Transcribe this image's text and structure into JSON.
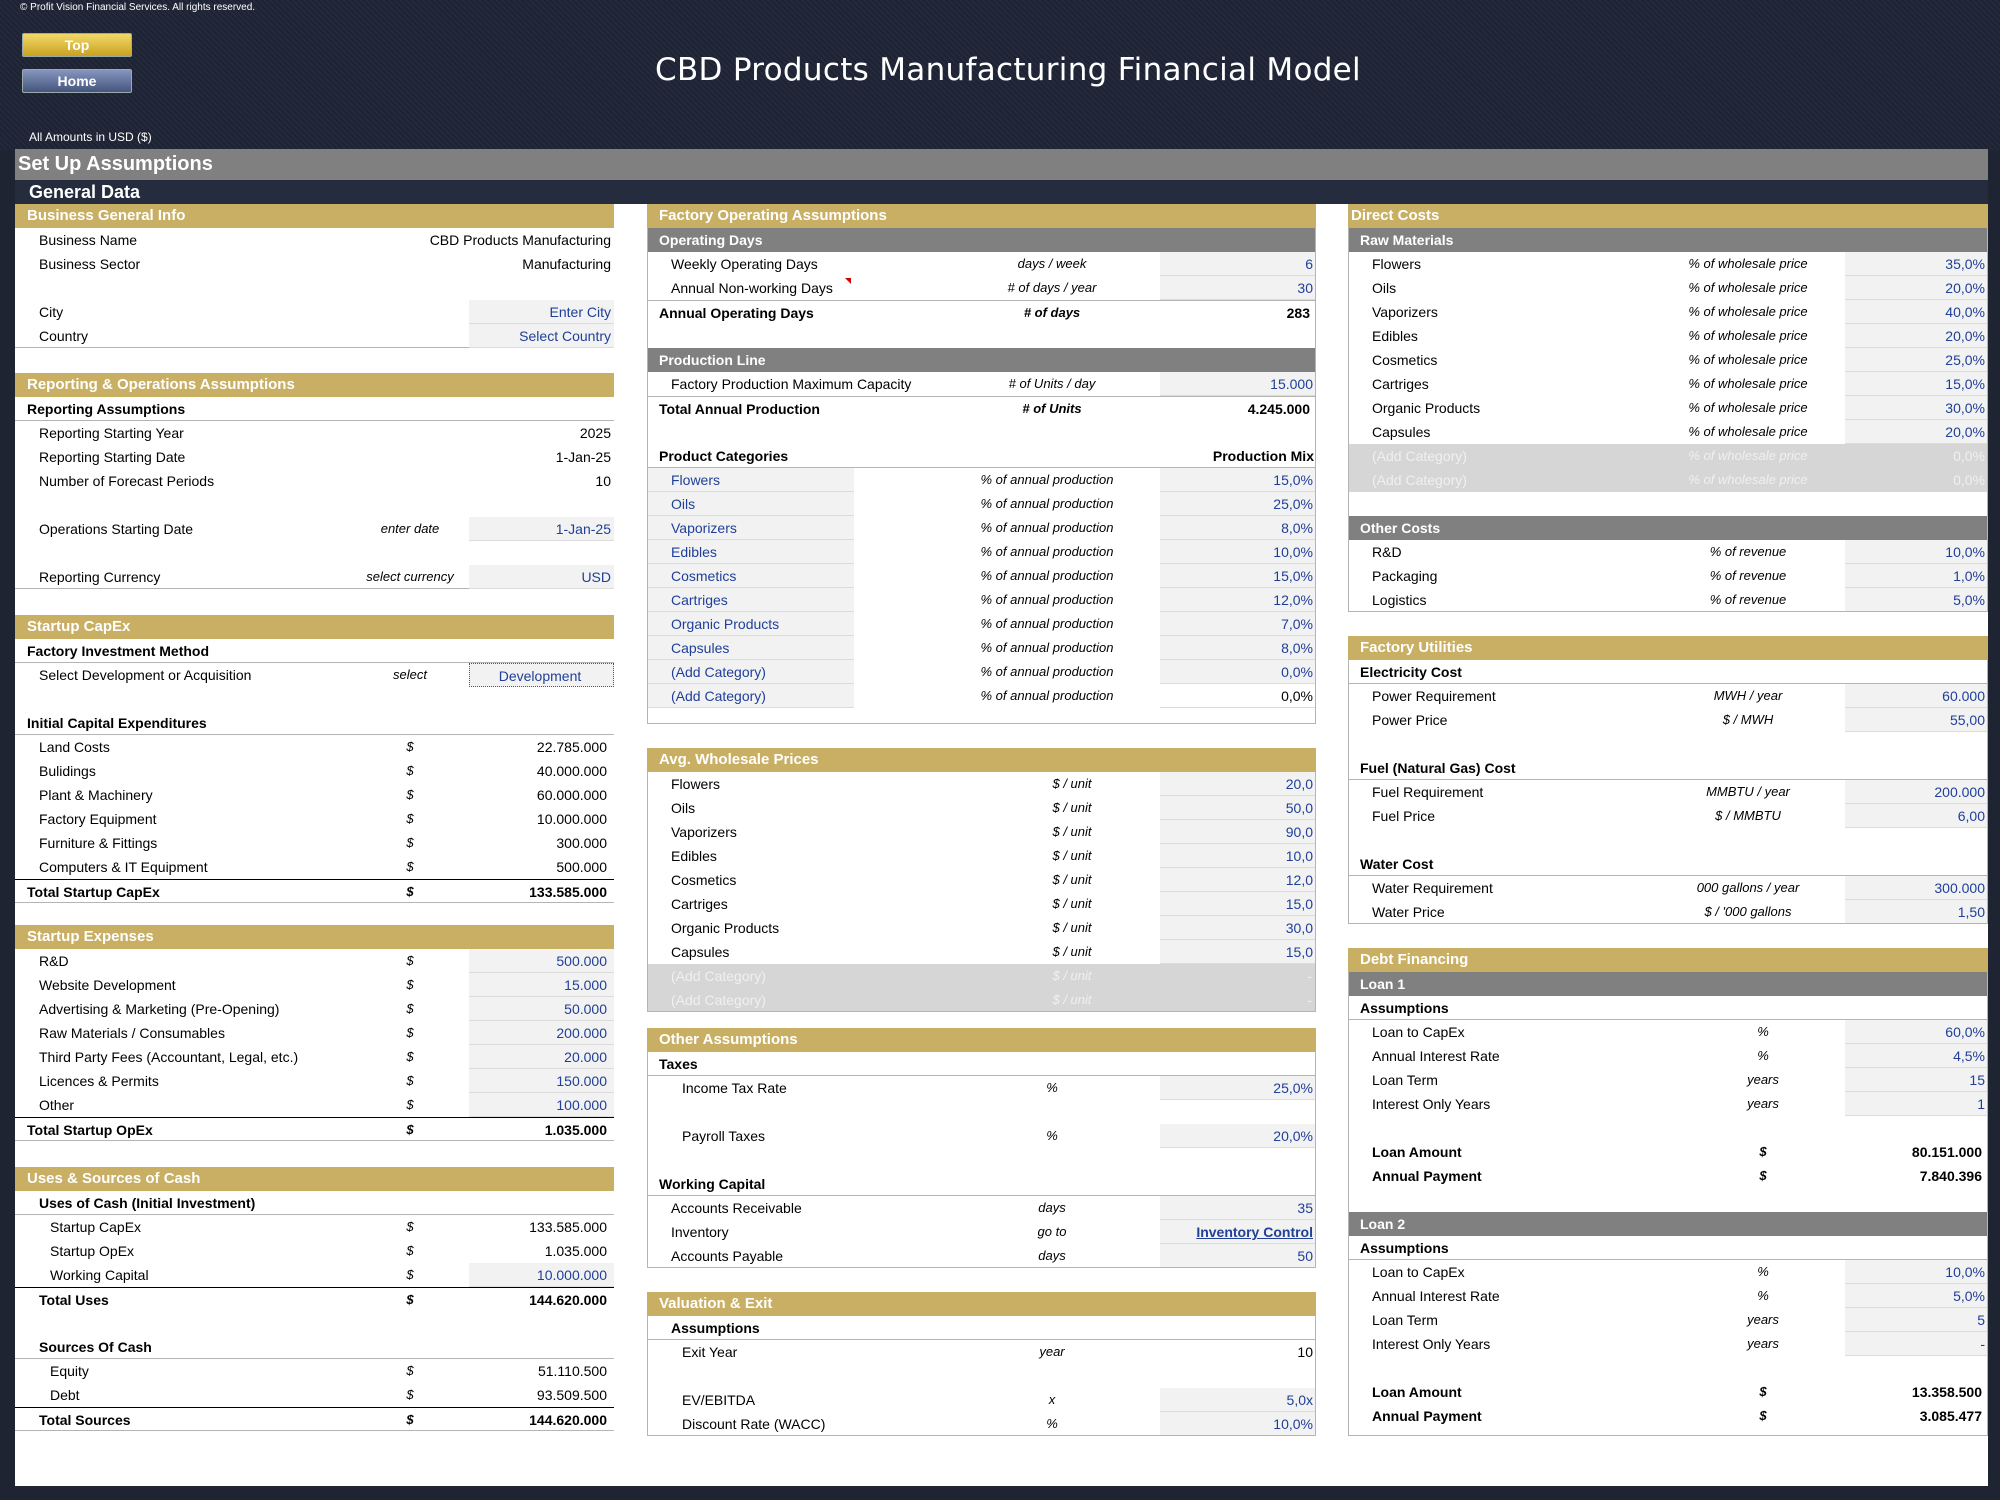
{
  "header": {
    "copyright": "© Profit Vision Financial Services. All rights reserved.",
    "top_button": "Top",
    "home_button": "Home",
    "title": "CBD Products Manufacturing Financial Model",
    "amounts": "All Amounts in  USD ($)"
  },
  "sections": {
    "setup": "Set Up Assumptions",
    "general": "General Data"
  },
  "business": {
    "title": "Business General Info",
    "name_label": "Business Name",
    "name_value": "CBD Products Manufacturing",
    "sector_label": "Business Sector",
    "sector_value": "Manufacturing",
    "city_label": "City",
    "city_value": "Enter City",
    "country_label": "Country",
    "country_value": "Select Country"
  },
  "reporting": {
    "title": "Reporting & Operations Assumptions",
    "sub": "Reporting Assumptions",
    "year_label": "Reporting Starting Year",
    "year_value": "2025",
    "date_label": "Reporting Starting Date",
    "date_value": "1-Jan-25",
    "periods_label": "Number of Forecast Periods",
    "periods_value": "10",
    "ops_label": "Operations Starting Date",
    "ops_unit": "enter date",
    "ops_value": "1-Jan-25",
    "currency_label": "Reporting Currency",
    "currency_unit": "select currency",
    "currency_value": "USD"
  },
  "capex": {
    "title": "Startup CapEx",
    "method_title": "Factory Investment Method",
    "select_label": "Select Development or Acquisition",
    "select_unit": "select",
    "select_value": "Development",
    "initial_title": "Initial Capital Expenditures",
    "items": [
      {
        "label": "Land Costs",
        "unit": "$",
        "value": "22.785.000"
      },
      {
        "label": "Bulidings",
        "unit": "$",
        "value": "40.000.000"
      },
      {
        "label": "Plant & Machinery",
        "unit": "$",
        "value": "60.000.000"
      },
      {
        "label": "Factory Equipment",
        "unit": "$",
        "value": "10.000.000"
      },
      {
        "label": "Furniture & Fittings",
        "unit": "$",
        "value": "300.000"
      },
      {
        "label": "Computers & IT Equipment",
        "unit": "$",
        "value": "500.000"
      }
    ],
    "total_label": "Total Startup CapEx",
    "total_unit": "$",
    "total_value": "133.585.000"
  },
  "expenses": {
    "title": "Startup Expenses",
    "items": [
      {
        "label": "R&D",
        "unit": "$",
        "value": "500.000"
      },
      {
        "label": "Website Development",
        "unit": "$",
        "value": "15.000"
      },
      {
        "label": "Advertising & Marketing (Pre-Opening)",
        "unit": "$",
        "value": "50.000"
      },
      {
        "label": "Raw Materials / Consumables",
        "unit": "$",
        "value": "200.000"
      },
      {
        "label": "Third Party Fees (Accountant, Legal, etc.)",
        "unit": "$",
        "value": "20.000"
      },
      {
        "label": "Licences & Permits",
        "unit": "$",
        "value": "150.000"
      },
      {
        "label": "Other",
        "unit": "$",
        "value": "100.000"
      }
    ],
    "total_label": "Total Startup OpEx",
    "total_unit": "$",
    "total_value": "1.035.000"
  },
  "uses": {
    "title": "Uses & Sources of Cash",
    "uses_title": "Uses of Cash (Initial Investment)",
    "capex_label": "Startup CapEx",
    "capex_unit": "$",
    "capex_value": "133.585.000",
    "opex_label": "Startup OpEx",
    "opex_unit": "$",
    "opex_value": "1.035.000",
    "wc_label": "Working Capital",
    "wc_unit": "$",
    "wc_value": "10.000.000",
    "total_uses_label": "Total Uses",
    "total_uses_unit": "$",
    "total_uses_value": "144.620.000",
    "sources_title": "Sources Of Cash",
    "equity_label": "Equity",
    "equity_unit": "$",
    "equity_value": "51.110.500",
    "debt_label": "Debt",
    "debt_unit": "$",
    "debt_value": "93.509.500",
    "total_sources_label": "Total Sources",
    "total_sources_unit": "$",
    "total_sources_value": "144.620.000"
  },
  "factory": {
    "title": "Factory Operating Assumptions",
    "opdays_title": "Operating Days",
    "weekly_label": "Weekly Operating Days",
    "weekly_unit": "days / week",
    "weekly_value": "6",
    "nonwork_label": "Annual Non-working Days",
    "nonwork_unit": "# of days / year",
    "nonwork_value": "30",
    "annual_label": "Annual Operating Days",
    "annual_unit": "# of days",
    "annual_value": "283",
    "prod_title": "Production Line",
    "capacity_label": "Factory Production Maximum Capacity",
    "capacity_unit": "# of Units / day",
    "capacity_value": "15.000",
    "total_prod_label": "Total Annual Production",
    "total_prod_unit": "# of Units",
    "total_prod_value": "4.245.000",
    "cats_title": "Product Categories",
    "mix_title": "Production Mix",
    "categories": [
      {
        "label": "Flowers",
        "unit": "% of annual production",
        "value": "15,0%"
      },
      {
        "label": "Oils",
        "unit": "% of annual production",
        "value": "25,0%"
      },
      {
        "label": "Vaporizers",
        "unit": "% of annual production",
        "value": "8,0%"
      },
      {
        "label": "Edibles",
        "unit": "% of annual production",
        "value": "10,0%"
      },
      {
        "label": "Cosmetics",
        "unit": "% of annual production",
        "value": "15,0%"
      },
      {
        "label": "Cartriges",
        "unit": "% of annual production",
        "value": "12,0%"
      },
      {
        "label": "Organic Products",
        "unit": "% of annual production",
        "value": "7,0%"
      },
      {
        "label": "Capsules",
        "unit": "% of annual production",
        "value": "8,0%"
      },
      {
        "label": "(Add Category)",
        "unit": "% of annual production",
        "value": "0,0%"
      },
      {
        "label": "(Add Category)",
        "unit": "% of annual production",
        "value": "0,0%"
      }
    ]
  },
  "prices": {
    "title": "Avg. Wholesale Prices",
    "items": [
      {
        "label": "Flowers",
        "unit": "$ / unit",
        "value": "20,0"
      },
      {
        "label": "Oils",
        "unit": "$ / unit",
        "value": "50,0"
      },
      {
        "label": "Vaporizers",
        "unit": "$ / unit",
        "value": "90,0"
      },
      {
        "label": "Edibles",
        "unit": "$ / unit",
        "value": "10,0"
      },
      {
        "label": "Cosmetics",
        "unit": "$ / unit",
        "value": "12,0"
      },
      {
        "label": "Cartriges",
        "unit": "$ / unit",
        "value": "15,0"
      },
      {
        "label": "Organic Products",
        "unit": "$ / unit",
        "value": "30,0"
      },
      {
        "label": "Capsules",
        "unit": "$ / unit",
        "value": "15,0"
      }
    ],
    "disabled": [
      {
        "label": "(Add Category)",
        "unit": "$ / unit",
        "value": "-"
      },
      {
        "label": "(Add Category)",
        "unit": "$ / unit",
        "value": "-"
      }
    ]
  },
  "other": {
    "title": "Other Assumptions",
    "taxes_title": "Taxes",
    "income_label": "Income Tax Rate",
    "income_unit": "%",
    "income_value": "25,0%",
    "payroll_label": "Payroll Taxes",
    "payroll_unit": "%",
    "payroll_value": "20,0%",
    "wc_title": "Working Capital",
    "ar_label": "Accounts Receivable",
    "ar_unit": "days",
    "ar_value": "35",
    "inv_label": "Inventory",
    "inv_unit": "go to",
    "inv_value": "Inventory Control",
    "ap_label": "Accounts Payable",
    "ap_unit": "days",
    "ap_value": "50"
  },
  "valuation": {
    "title": "Valuation & Exit",
    "sub": "Assumptions",
    "exit_label": "Exit Year",
    "exit_unit": "year",
    "exit_value": "10",
    "ev_label": "EV/EBITDA",
    "ev_unit": "x",
    "ev_value": "5,0x",
    "wacc_label": "Discount Rate (WACC)",
    "wacc_unit": "%",
    "wacc_value": "10,0%"
  },
  "direct": {
    "title": "Direct Costs",
    "raw_title": "Raw Materials",
    "raw": [
      {
        "label": "Flowers",
        "unit": "% of wholesale price",
        "value": "35,0%"
      },
      {
        "label": "Oils",
        "unit": "% of wholesale price",
        "value": "20,0%"
      },
      {
        "label": "Vaporizers",
        "unit": "% of wholesale price",
        "value": "40,0%"
      },
      {
        "label": "Edibles",
        "unit": "% of wholesale price",
        "value": "20,0%"
      },
      {
        "label": "Cosmetics",
        "unit": "% of wholesale price",
        "value": "25,0%"
      },
      {
        "label": "Cartriges",
        "unit": "% of wholesale price",
        "value": "15,0%"
      },
      {
        "label": "Organic Products",
        "unit": "% of wholesale price",
        "value": "30,0%"
      },
      {
        "label": "Capsules",
        "unit": "% of wholesale price",
        "value": "20,0%"
      }
    ],
    "raw_disabled": [
      {
        "label": "(Add Category)",
        "unit": "% of wholesale price",
        "value": "0,0%"
      },
      {
        "label": "(Add Category)",
        "unit": "% of wholesale price",
        "value": "0,0%"
      }
    ],
    "other_title": "Other Costs",
    "other": [
      {
        "label": "R&D",
        "unit": "% of revenue",
        "value": "10,0%"
      },
      {
        "label": "Packaging",
        "unit": "% of revenue",
        "value": "1,0%"
      },
      {
        "label": "Logistics",
        "unit": "% of revenue",
        "value": "5,0%"
      }
    ]
  },
  "utilities": {
    "title": "Factory Utilities",
    "elec_title": "Electricity Cost",
    "power_req_label": "Power Requirement",
    "power_req_unit": "MWH / year",
    "power_req_value": "60.000",
    "power_price_label": "Power Price",
    "power_price_unit": "$ / MWH",
    "power_price_value": "55,00",
    "fuel_title": "Fuel (Natural Gas) Cost",
    "fuel_req_label": "Fuel Requirement",
    "fuel_req_unit": "MMBTU / year",
    "fuel_req_value": "200.000",
    "fuel_price_label": "Fuel Price",
    "fuel_price_unit": "$ / MMBTU",
    "fuel_price_value": "6,00",
    "water_title": "Water Cost",
    "water_req_label": "Water Requirement",
    "water_req_unit": "000 gallons / year",
    "water_req_value": "300.000",
    "water_price_label": "Water Price",
    "water_price_unit": "$ / '000 gallons",
    "water_price_value": "1,50"
  },
  "debt": {
    "title": "Debt Financing",
    "loan1": {
      "title": "Loan 1",
      "assumptions": "Assumptions",
      "ltc_label": "Loan to CapEx",
      "ltc_unit": "%",
      "ltc_value": "60,0%",
      "rate_label": "Annual Interest Rate",
      "rate_unit": "%",
      "rate_value": "4,5%",
      "term_label": "Loan Term",
      "term_unit": "years",
      "term_value": "15",
      "io_label": "Interest Only Years",
      "io_unit": "years",
      "io_value": "1",
      "amount_label": "Loan Amount",
      "amount_unit": "$",
      "amount_value": "80.151.000",
      "payment_label": "Annual Payment",
      "payment_unit": "$",
      "payment_value": "7.840.396"
    },
    "loan2": {
      "title": "Loan 2",
      "assumptions": "Assumptions",
      "ltc_label": "Loan to CapEx",
      "ltc_unit": "%",
      "ltc_value": "10,0%",
      "rate_label": "Annual Interest Rate",
      "rate_unit": "%",
      "rate_value": "5,0%",
      "term_label": "Loan Term",
      "term_unit": "years",
      "term_value": "5",
      "io_label": "Interest Only Years",
      "io_unit": "years",
      "io_value": "-",
      "amount_label": "Loan Amount",
      "amount_unit": "$",
      "amount_value": "13.358.500",
      "payment_label": "Annual Payment",
      "payment_unit": "$",
      "payment_value": "3.085.477"
    }
  }
}
